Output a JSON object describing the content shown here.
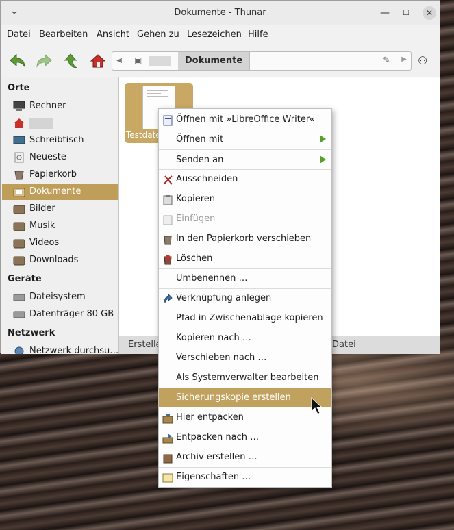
{
  "window": {
    "title": "Dokumente - Thunar"
  },
  "menubar": [
    "Datei",
    "Bearbeiten",
    "Ansicht",
    "Gehen zu",
    "Lesezeichen",
    "Hilfe"
  ],
  "pathbar": {
    "current": "Dokumente"
  },
  "sidebar": {
    "orte_heading": "Orte",
    "orte": [
      {
        "label": "Rechner",
        "icon": "computer-icon"
      },
      {
        "label": "",
        "icon": "home-icon"
      },
      {
        "label": "Schreibtisch",
        "icon": "desktop-icon"
      },
      {
        "label": "Neueste",
        "icon": "recent-icon"
      },
      {
        "label": "Papierkorb",
        "icon": "trash-icon"
      },
      {
        "label": "Dokumente",
        "icon": "folder-documents-icon"
      },
      {
        "label": "Bilder",
        "icon": "folder-pictures-icon"
      },
      {
        "label": "Musik",
        "icon": "folder-music-icon"
      },
      {
        "label": "Videos",
        "icon": "folder-videos-icon"
      },
      {
        "label": "Downloads",
        "icon": "folder-downloads-icon"
      }
    ],
    "geraete_heading": "Geräte",
    "geraete": [
      {
        "label": "Dateisystem",
        "icon": "drive-icon"
      },
      {
        "label": "Datenträger 80 GB",
        "icon": "drive-icon"
      }
    ],
    "netzwerk_heading": "Netzwerk",
    "netzwerk": [
      {
        "label": "Netzwerk durchsu…",
        "icon": "network-icon"
      }
    ]
  },
  "content": {
    "file_label": "Testdate"
  },
  "statusbar": {
    "left": "Erstelle",
    "right": "Datei"
  },
  "context_menu": [
    {
      "label": "Öffnen mit »LibreOffice Writer«",
      "icon": "writer-icon"
    },
    {
      "label": "Öffnen mit",
      "submenu": true
    },
    {
      "label": "Senden an",
      "submenu": true
    },
    {
      "label": "Ausschneiden",
      "icon": "cut-icon"
    },
    {
      "label": "Kopieren",
      "icon": "copy-icon"
    },
    {
      "label": "Einfügen",
      "icon": "paste-icon",
      "disabled": true
    },
    {
      "label": "In den Papierkorb verschieben",
      "icon": "trash-icon"
    },
    {
      "label": "Löschen",
      "icon": "delete-icon"
    },
    {
      "label": "Umbenennen …"
    },
    {
      "label": "Verknüpfung anlegen",
      "icon": "link-icon"
    },
    {
      "label": "Pfad in Zwischenablage kopieren"
    },
    {
      "label": "Kopieren nach …"
    },
    {
      "label": "Verschieben nach …"
    },
    {
      "label": "Als Systemverwalter bearbeiten"
    },
    {
      "label": "Sicherungskopie erstellen",
      "highlighted": true
    },
    {
      "label": "Hier entpacken",
      "icon": "extract-icon"
    },
    {
      "label": "Entpacken nach …",
      "icon": "extract-to-icon"
    },
    {
      "label": "Archiv erstellen …",
      "icon": "archive-icon"
    },
    {
      "label": "Eigenschaften …",
      "icon": "properties-icon"
    }
  ],
  "colors": {
    "accent": "#bf9e5a",
    "submenu_arrow": "#57a02e"
  }
}
